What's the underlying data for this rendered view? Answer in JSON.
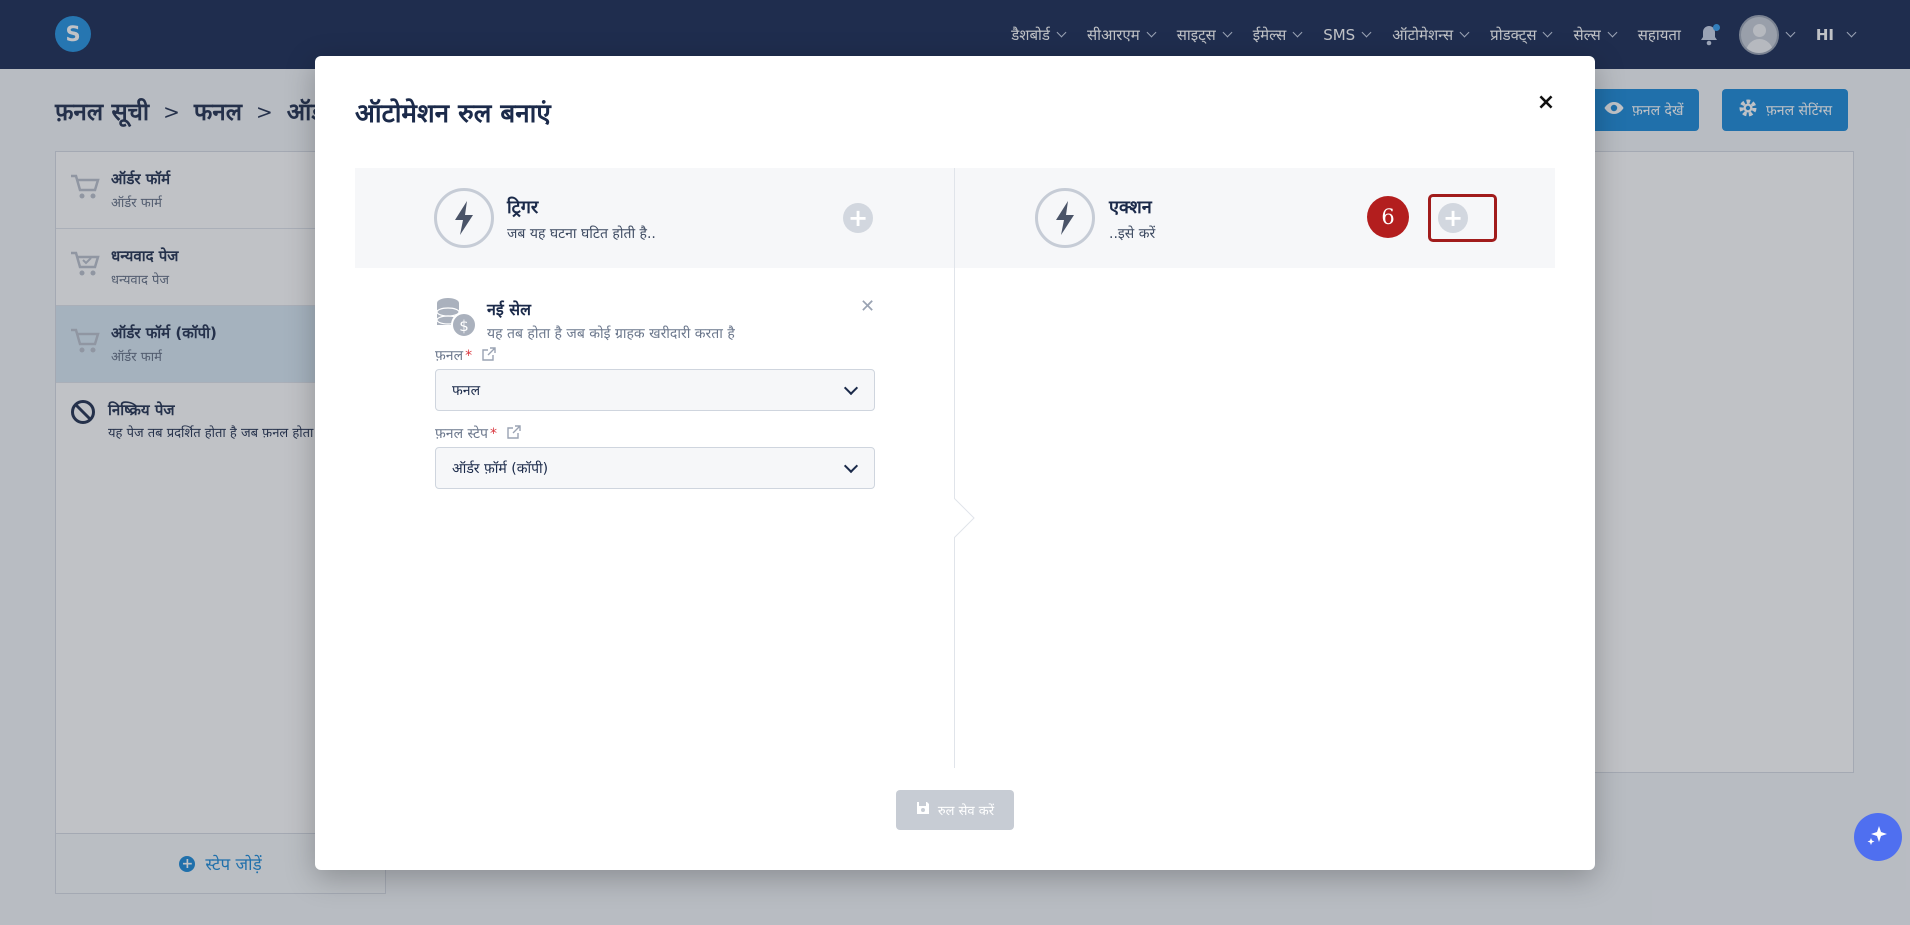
{
  "nav": {
    "logo": "S",
    "items": [
      {
        "label": "डैशबोर्ड"
      },
      {
        "label": "सीआरएम"
      },
      {
        "label": "साइट्स"
      },
      {
        "label": "ईमेल्स"
      },
      {
        "label": "SMS"
      },
      {
        "label": "ऑटोमेशन्स"
      },
      {
        "label": "प्रोडक्ट्स"
      },
      {
        "label": "सेल्स"
      }
    ],
    "help": "सहायता",
    "language": "HI"
  },
  "page": {
    "breadcrumb": [
      "फ़नल सूची",
      "फनल",
      "ऑर्ड"
    ],
    "view_funnel_button": "फ़नल देखें",
    "funnel_settings_button": "फ़नल सेटिंग्स",
    "sidebar": {
      "items": [
        {
          "title": "ऑर्डर फॉर्म",
          "subtitle": "ऑर्डर फार्म"
        },
        {
          "title": "धन्यवाद पेज",
          "subtitle": "धन्यवाद पेज"
        },
        {
          "title": "ऑर्डर फॉर्म (कॉपी)",
          "subtitle": "ऑर्डर फार्म"
        }
      ],
      "inactive": {
        "title": "निष्क्रिय पेज",
        "description": "यह पेज तब प्रदर्शित होता है जब फ़नल होता है"
      },
      "add_step": "स्टेप जोड़ें"
    }
  },
  "modal": {
    "title": "ऑटोमेशन रुल बनाएं",
    "close": "×",
    "trigger": {
      "title": "ट्रिगर",
      "subtitle": "जब यह घटना घटित होती है.."
    },
    "action": {
      "title": "एक्शन",
      "subtitle": "..इसे करें"
    },
    "step_badge": "6",
    "trigger_card": {
      "title": "नई सेल",
      "description": "यह तब होता है जब कोई ग्राहक खरीदारी करता है"
    },
    "fields": {
      "funnel_label": "फ़नल",
      "funnel_value": "फनल",
      "step_label": "फ़नल स्टेप",
      "step_value": "ऑर्डर फ़ॉर्म (कॉपी)"
    },
    "save_button": "रुल सेव करें"
  },
  "colors": {
    "nav_bg": "#12244f",
    "primary": "#1487d8",
    "badge": "#b31e1e",
    "highlight_border": "#a11c1c"
  }
}
